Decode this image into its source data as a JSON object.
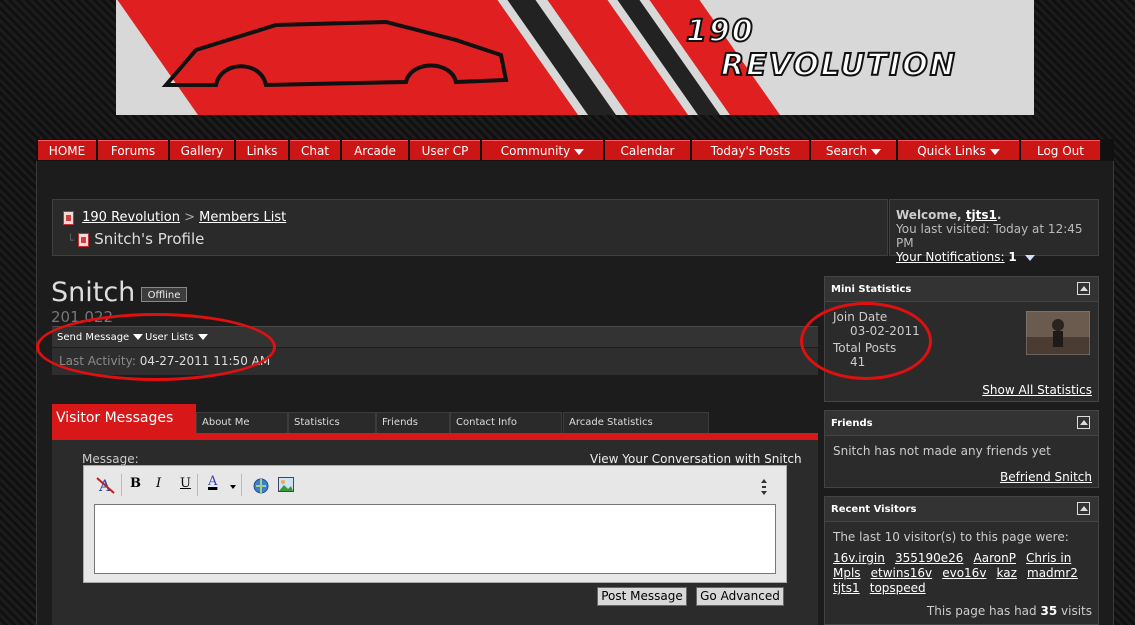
{
  "banner": {
    "line1": "190",
    "line2": "REVOLUTION"
  },
  "nav": [
    {
      "label": "HOME"
    },
    {
      "label": "Forums"
    },
    {
      "label": "Gallery"
    },
    {
      "label": "Links"
    },
    {
      "label": "Chat"
    },
    {
      "label": "Arcade"
    },
    {
      "label": "User CP"
    },
    {
      "label": "Community"
    },
    {
      "label": "Calendar"
    },
    {
      "label": "Today's Posts"
    },
    {
      "label": "Search"
    },
    {
      "label": "Quick Links"
    },
    {
      "label": "Log Out"
    }
  ],
  "breadcrumb": {
    "root": "190 Revolution",
    "separator": ">",
    "members": "Members List",
    "current": "Snitch's Profile"
  },
  "welcome": {
    "prefix": "Welcome,",
    "user": "tjts1",
    "suffix": ".",
    "last_visited": "You last visited: Today at 12:45 PM",
    "notifications_label": "Your Notifications:",
    "notifications_count": "1"
  },
  "profile": {
    "name": "Snitch",
    "status": "Offline",
    "stat": "201.022",
    "send_message": "Send Message",
    "user_lists": "User Lists",
    "last_activity_label": "Last Activity:",
    "last_activity_value": "04-27-2011 11:50 AM"
  },
  "tabs": {
    "active": "Visitor Messages",
    "others": [
      "About Me",
      "Statistics",
      "Friends",
      "Contact Info",
      "Arcade Statistics"
    ]
  },
  "message": {
    "label": "Message:",
    "conversation_link": "View Your Conversation with Snitch",
    "toolbar": {
      "bold": "B",
      "italic": "I",
      "underline": "U",
      "font_color": "A"
    },
    "post_button": "Post Message",
    "advanced_button": "Go Advanced"
  },
  "mini_stats": {
    "title": "Mini Statistics",
    "join_label": "Join Date",
    "join_value": "03-02-2011",
    "posts_label": "Total Posts",
    "posts_value": "41",
    "show_all": "Show All Statistics"
  },
  "friends": {
    "title": "Friends",
    "text": "Snitch has not made any friends yet",
    "befriend": "Befriend Snitch"
  },
  "recent_visitors": {
    "title": "Recent Visitors",
    "intro": "The last 10 visitor(s) to this page were:",
    "visitors": [
      "16v.irgin",
      "355190e26",
      "AaronP",
      "Chris in Mpls",
      "etwins16v",
      "evo16v",
      "kaz",
      "madmr2",
      "tjts1",
      "topspeed"
    ],
    "visits_prefix": "This page has had",
    "visits_count": "35",
    "visits_suffix": "visits"
  },
  "colors": {
    "accent": "#d81818",
    "annotation": "#e01010"
  }
}
